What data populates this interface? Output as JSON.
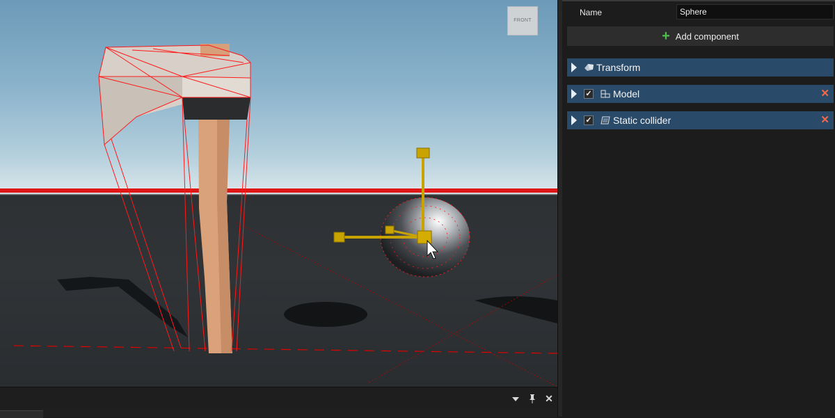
{
  "viewport": {
    "view_cube_label": "FRONT"
  },
  "properties": {
    "name_label": "Name",
    "name_value": "Sphere",
    "add_component_label": "Add component",
    "components": [
      {
        "label": "Transform",
        "icon": "transform-icon",
        "checkable": false,
        "removable": false
      },
      {
        "label": "Model",
        "icon": "model-icon",
        "checkable": true,
        "checked": true,
        "removable": true
      },
      {
        "label": "Static collider",
        "icon": "collider-icon",
        "checkable": true,
        "checked": true,
        "removable": true
      }
    ]
  },
  "bottom_panel": {
    "dropdown_icon": "chevron-down-icon",
    "pin_icon": "pin-icon",
    "close_icon": "close-icon"
  },
  "colors": {
    "selection_wire": "#ff1a1a",
    "gizmo": "#c9a400",
    "component_header": "#2a4a6a",
    "remove": "#f46a4a"
  }
}
